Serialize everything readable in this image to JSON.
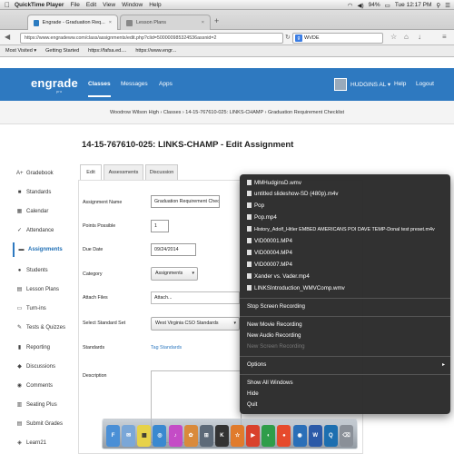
{
  "menubar": {
    "apple": "",
    "app": "QuickTime Player",
    "items": [
      "File",
      "Edit",
      "View",
      "Window",
      "Help"
    ],
    "battery": "94%",
    "clock": "Tue 12:17 PM"
  },
  "browser": {
    "tabs": [
      {
        "label": "Engrade - Graduation Req...",
        "close": "×"
      },
      {
        "label": "Lesson Plans",
        "close": "×"
      }
    ],
    "new_tab": "+",
    "url": "https://www.engradeww.com/class/assignments/edit.php?clid=500000985324536assnid=2",
    "search": "WVDE",
    "bookmarks": [
      "Most Visited ▾",
      "Getting Started",
      "https://fafsa.ed....",
      "https://www.engr..."
    ]
  },
  "app": {
    "logo": "engrade",
    "logo_sub": "pro",
    "nav": [
      "Classes",
      "Messages",
      "Apps"
    ],
    "user": "HUDGINS AL ▾",
    "help": "Help",
    "logout": "Logout"
  },
  "breadcrumb": "Woodrow Wilson High  ›  Classes  ›  14-15-767610-025: LINKS-CHAMP  ›  Graduation Requirement Checklist",
  "page_title": "14-15-767610-025: LINKS-CHAMP - Edit Assignment",
  "sidebar": [
    {
      "icon": "A+",
      "label": "Gradebook"
    },
    {
      "icon": "■",
      "label": "Standards"
    },
    {
      "icon": "▦",
      "label": "Calendar"
    },
    {
      "icon": "✓",
      "label": "Attendance"
    },
    {
      "icon": "▬",
      "label": "Assignments"
    },
    {
      "icon": "●",
      "label": "Students"
    },
    {
      "icon": "▤",
      "label": "Lesson Plans"
    },
    {
      "icon": "▭",
      "label": "Turn-ins"
    },
    {
      "icon": "✎",
      "label": "Tests & Quizzes"
    },
    {
      "icon": "▮",
      "label": "Reporting"
    },
    {
      "icon": "◆",
      "label": "Discussions"
    },
    {
      "icon": "◉",
      "label": "Comments"
    },
    {
      "icon": "▥",
      "label": "Seating Plus"
    },
    {
      "icon": "▤",
      "label": "Submit Grades"
    },
    {
      "icon": "◈",
      "label": "Learn21"
    }
  ],
  "tabs": [
    "Edit",
    "Assessments",
    "Discussion"
  ],
  "form": {
    "name_label": "Assignment Name",
    "name_value": "Graduation Requirement Checl",
    "points_label": "Points Possible",
    "points_value": "1",
    "due_label": "Due Date",
    "due_value": "09/24/2014",
    "category_label": "Category",
    "category_value": "Assignments",
    "attach_label": "Attach Files",
    "attach_value": "Attach...",
    "standard_label": "Select Standard Set",
    "standard_value": "West Virginia CSO Standards",
    "standards_label": "Standards",
    "tag_link": "Tag Standards",
    "description_label": "Description"
  },
  "context_menu": {
    "files": [
      "MMHudginsD.wmv",
      "untitled slideshow-SD (480p).m4v",
      "Pop",
      "Pop.mp4",
      "History_Adolf_Hitler EMBED AMERICANS POI DAVE TEMP-Donal test preset.m4v",
      "VID00001.MP4",
      "VID00004.MP4",
      "VID00007.MP4",
      "Xander vs. Vader.mp4",
      "LINKSIntroduction_WMVComp.wmv"
    ],
    "stop": "Stop Screen Recording",
    "new_movie": "New Movie Recording",
    "new_audio": "New Audio Recording",
    "new_screen": "New Screen Recording",
    "options": "Options",
    "options_arrow": "▸",
    "show_all": "Show All Windows",
    "hide": "Hide",
    "quit": "Quit"
  },
  "dock": [
    "F",
    "✉",
    "▦",
    "◎",
    "♪",
    "✿",
    "⊞",
    "K",
    "☆",
    "▶",
    "◐",
    "●",
    "◉",
    "W",
    "Q",
    "⌫"
  ]
}
